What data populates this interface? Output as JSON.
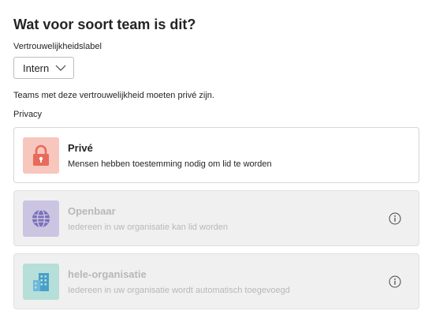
{
  "dialog": {
    "title": "Wat voor soort team is dit?"
  },
  "sensitivity": {
    "label": "Vertrouwelijkheidslabel",
    "selected": "Intern",
    "help_text": "Teams met deze vertrouwelijkheid moeten privé zijn."
  },
  "privacy": {
    "label": "Privacy",
    "options": [
      {
        "title": "Privé",
        "description": "Mensen hebben toestemming nodig om lid te worden",
        "icon": "lock-icon",
        "tile_color": "#f7c6bd",
        "icon_color": "#e86a5b",
        "enabled": true
      },
      {
        "title": "Openbaar",
        "description": "Iedereen in uw organisatie kan lid worden",
        "icon": "globe-icon",
        "tile_color": "#cbc5e2",
        "icon_color": "#7b71b8",
        "enabled": false
      },
      {
        "title": "hele-organisatie",
        "description": "Iedereen in uw organisatie wordt automatisch toegevoegd",
        "icon": "building-icon",
        "tile_color": "#b5dfd8",
        "icon_color": "#4a9fc9",
        "enabled": false
      }
    ]
  }
}
